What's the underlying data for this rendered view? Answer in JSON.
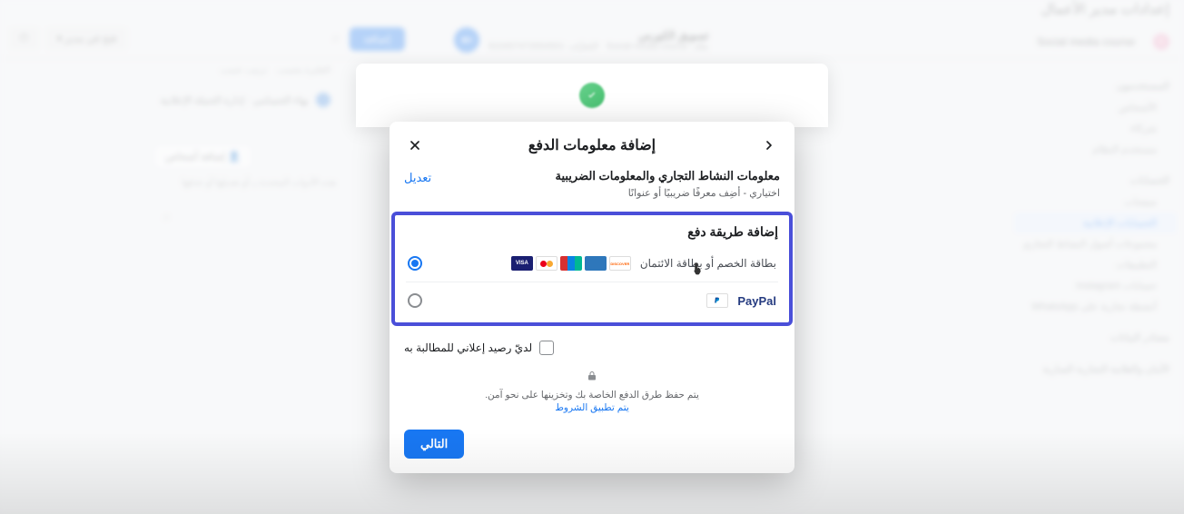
{
  "bg": {
    "page_title": "إعدادات مدير الأعمال",
    "account_pill": "Social media course",
    "sidebar": {
      "group1": "المستخدمون",
      "group1_items": [
        "الأشخاص",
        "شركاء",
        "مستخدم النظام"
      ],
      "group2": "الحسابات",
      "group2_items": [
        "صفحات",
        "الحسابات الإعلانية",
        "مجموعات أصول النشاط التجاري",
        "التطبيقات",
        "حسابات Instagram",
        "أنشطة تجارية على WhatsApp"
      ],
      "group3": "مصادر البيانات",
      "group4": "الأمان والعلامة التجارية السارية"
    },
    "active_item": "الحسابات الإعلانية",
    "course_name": "تسويق الكورس",
    "course_sub_label": "ملك:",
    "course_sub_owner": "Social media course",
    "course_sub_id_label": "المُعرِّف:",
    "course_id": "910457472654501",
    "btn_add": "إضافة",
    "search_ph": "البحث وفقًا للاسم أو المعرف",
    "filter1": "الفلترة بحسب",
    "filter2": "ترتيب حسب",
    "info_row": "بهاء الحسامي · إدارة الحملة الإعلانية",
    "add_people": "إضافة أشخاص",
    "hint": "هذه الأدوات المحددة بـ أو تعديلها أو حذفها",
    "topright_pill": "فتح في مدير ▾"
  },
  "modal": {
    "title": "إضافة معلومات الدفع",
    "biz_title": "معلومات النشاط التجاري والمعلومات الضريبية",
    "biz_sub": "اختياري - أضِف معرفًا ضريبيًا أو عنوانًا",
    "edit": "تعديل",
    "pm_title": "إضافة طريقة دفع",
    "opt_card": "بطاقة الخصم أو بطاقة الائتمان",
    "opt_paypal": "PayPal",
    "card_brands": {
      "visa": "VISA",
      "disc": "DISCOVER"
    },
    "credit_label": "لديّ رصيد إعلاني للمطالبة به",
    "secure_text": "يتم حفظ طرق الدفع الخاصة بك وتخزينها على نحو آمن.",
    "terms": "يتم تطبيق الشروط",
    "next": "التالي"
  }
}
